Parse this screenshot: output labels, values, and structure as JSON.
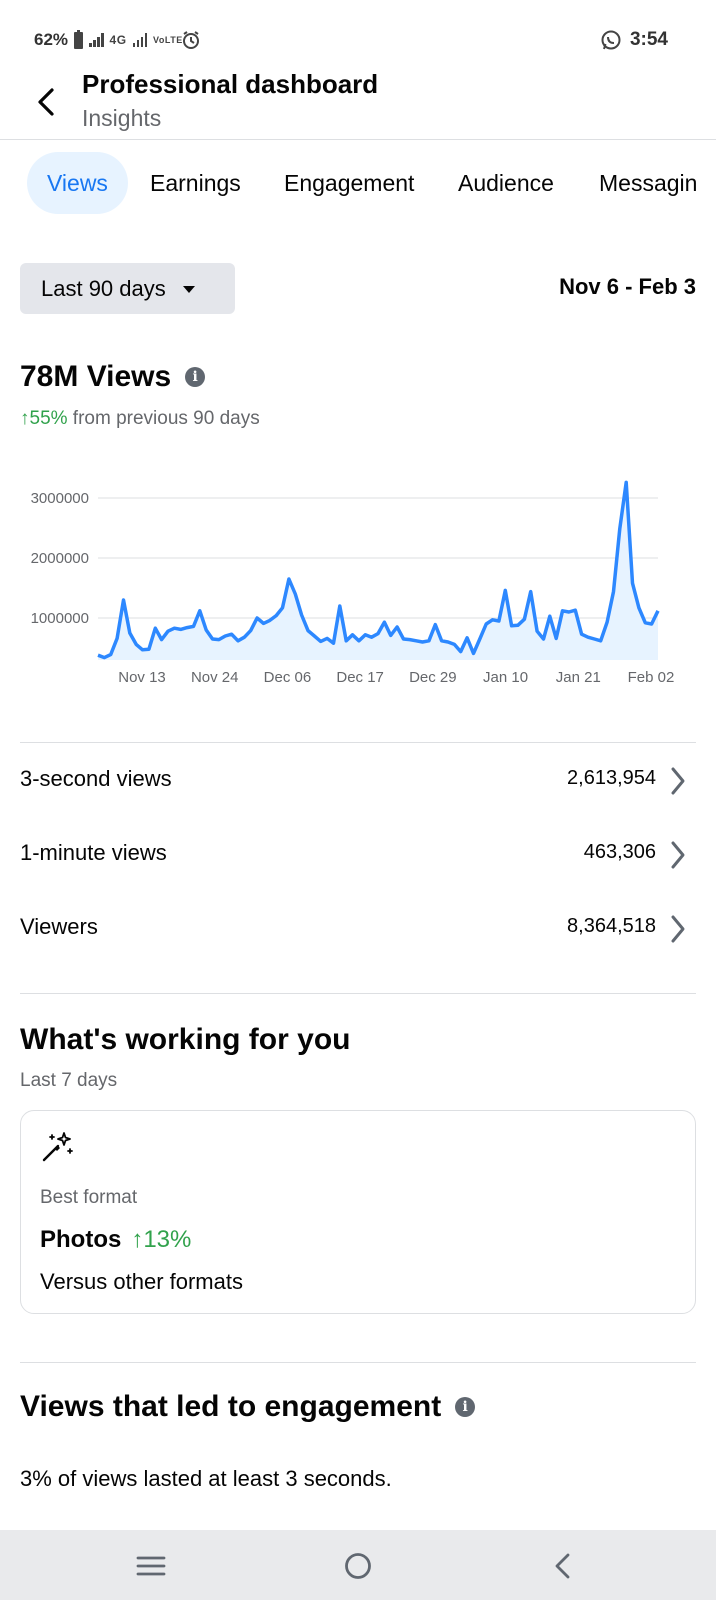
{
  "status_bar": {
    "battery": "62%",
    "network": "4G",
    "volte": "VoLTE2",
    "time": "3:54",
    "icons": [
      "battery-icon",
      "signal-icon",
      "alarm-icon",
      "whatsapp-icon"
    ]
  },
  "header": {
    "title": "Professional dashboard",
    "subtitle": "Insights"
  },
  "tabs": [
    {
      "label": "Views",
      "active": true
    },
    {
      "label": "Earnings",
      "active": false
    },
    {
      "label": "Engagement",
      "active": false
    },
    {
      "label": "Audience",
      "active": false
    },
    {
      "label": "Messagin",
      "active": false
    }
  ],
  "range": {
    "selected": "Last 90 days",
    "dates": "Nov 6 - Feb 3"
  },
  "views": {
    "title": "78M Views",
    "change_arrow": "↑",
    "change_value": "55%",
    "change_text": " from previous 90 days"
  },
  "chart_data": {
    "type": "area",
    "y_ticks": [
      "3000000",
      "2000000",
      "1000000"
    ],
    "x_ticks": [
      "Nov 13",
      "Nov 24",
      "Dec 06",
      "Dec 17",
      "Dec 29",
      "Jan 10",
      "Jan 21",
      "Feb 02"
    ],
    "ylim": [
      300000,
      3300000
    ],
    "grid": true,
    "line_color": "#2d88ff",
    "fill_color": "#e7f3ff",
    "series": [
      {
        "values": [
          380000,
          340000,
          390000,
          660000,
          1300000,
          750000,
          560000,
          470000,
          480000,
          830000,
          640000,
          780000,
          830000,
          810000,
          840000,
          860000,
          1120000,
          800000,
          650000,
          640000,
          700000,
          730000,
          620000,
          680000,
          790000,
          1000000,
          910000,
          960000,
          1040000,
          1170000,
          1650000,
          1400000,
          1050000,
          790000,
          700000,
          610000,
          660000,
          580000,
          1200000,
          620000,
          720000,
          620000,
          720000,
          680000,
          740000,
          930000,
          710000,
          850000,
          650000,
          640000,
          620000,
          600000,
          620000,
          890000,
          620000,
          600000,
          560000,
          440000,
          670000,
          410000,
          650000,
          900000,
          970000,
          950000,
          1460000,
          870000,
          880000,
          980000,
          1440000,
          780000,
          650000,
          1030000,
          660000,
          1120000,
          1100000,
          1130000,
          730000,
          680000,
          650000,
          620000,
          930000,
          1440000,
          2490000,
          3260000,
          1580000,
          1170000,
          920000,
          900000,
          1120000
        ]
      }
    ]
  },
  "metrics": [
    {
      "label": "3-second views",
      "value": "2,613,954"
    },
    {
      "label": "1-minute views",
      "value": "463,306"
    },
    {
      "label": "Viewers",
      "value": "8,364,518"
    }
  ],
  "working": {
    "title": "What's working for you",
    "subtitle": "Last 7 days",
    "card": {
      "label": "Best format",
      "format": "Photos",
      "change": "↑13%",
      "versus": "Versus other formats"
    }
  },
  "engagement": {
    "title": "Views that led to engagement",
    "text": "3% of views lasted at least 3 seconds."
  }
}
